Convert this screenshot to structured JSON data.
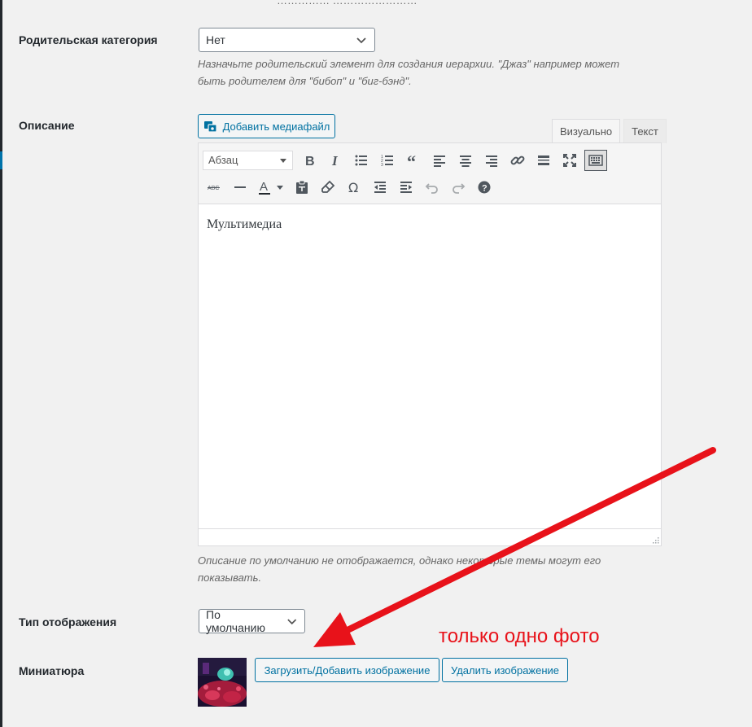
{
  "top_cut_text": "…………… ……………………",
  "parent_category": {
    "label": "Родительская категория",
    "value": "Нет",
    "hint": "Назначьте родительский элемент для создания иерархии. \"Джаз\" например может быть родителем для \"бибоп\" и \"биг-бэнд\"."
  },
  "description": {
    "label": "Описание",
    "add_media_label": "Добавить медиафайл",
    "tabs": [
      "Визуально",
      "Текст"
    ],
    "format_value": "Абзац",
    "content": "Мультимедиа",
    "hint": "Описание по умолчанию не отображается, однако некоторые темы могут его показывать."
  },
  "toolbar": {
    "row1": [
      "bold-icon",
      "italic-icon",
      "bullet-list-icon",
      "numbered-list-icon",
      "blockquote-icon",
      "align-left-icon",
      "align-center-icon",
      "align-right-icon",
      "link-icon",
      "read-more-icon",
      "fullscreen-icon",
      "toolbar-toggle-icon"
    ],
    "row2": [
      "strikethrough-icon",
      "horizontal-line-icon",
      "text-color-icon",
      "paste-text-icon",
      "clear-formatting-icon",
      "special-character-icon",
      "outdent-icon",
      "indent-icon",
      "undo-icon",
      "redo-icon",
      "help-icon"
    ]
  },
  "display_type": {
    "label": "Тип отображения",
    "value": "По умолчанию"
  },
  "thumbnail": {
    "label": "Миниатюра",
    "upload_label": "Загрузить/Добавить изображение",
    "remove_label": "Удалить изображение"
  },
  "annotation": {
    "text": "только одно фото",
    "color": "#e8121a"
  },
  "colors": {
    "accent": "#0071a1",
    "background": "#f1f1f1"
  }
}
